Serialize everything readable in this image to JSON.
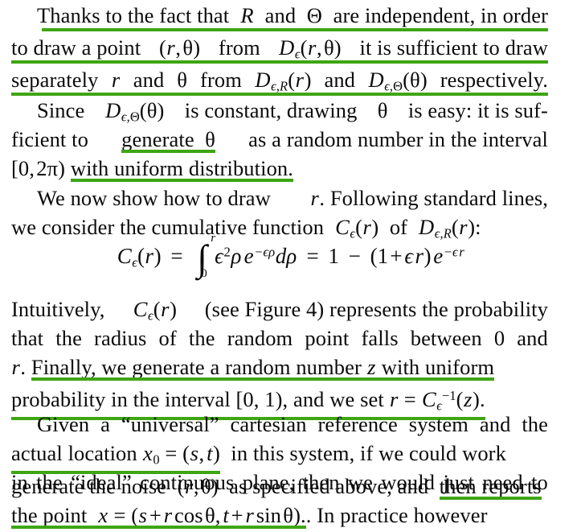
{
  "document": {
    "type": "scanned-paper-excerpt",
    "background_color": "#ffffff",
    "text_color": "#0b0b0b",
    "highlight_color": "#3ea513",
    "highlight_style": "green-underline"
  },
  "paragraphs": [
    {
      "id": "p1",
      "lines": [
        "Thanks to the fact that R and Θ are independent, in order",
        "to draw a point (r, θ) from Dε(r, θ) it is sufficient to draw",
        "separately r and θ from Dε,R(r) and Dε,Θ(θ) respectively."
      ],
      "underlined": "all-three-lines-full-width"
    },
    {
      "id": "p2",
      "lines": [
        "Since Dε,Θ(θ) is constant, drawing θ is easy: it is suf-",
        "ficient to generate θ as a random number in the interval",
        "[0, 2π) with uniform distribution."
      ],
      "underlined": [
        "generate θ",
        "with uniform distribution."
      ]
    },
    {
      "id": "p3",
      "lines": [
        "We now show how to draw r. Following standard lines,",
        "we consider the cumulative function Cε(r) of Dε,R(r):"
      ],
      "underlined": []
    },
    {
      "id": "p4",
      "lines": [
        "Intuitively, Cε(r) (see Figure 4) represents the probability",
        "that the radius of the random point falls between 0 and",
        "r. Finally, we generate a random number z with uniform",
        "probability in the interval [0, 1), and we set r = Cε⁻¹(z)."
      ],
      "underlined": [
        "Finally, we generate a random number z with uniform",
        "probability in the interval [0, 1), and we set r = Cε⁻¹(z)."
      ]
    },
    {
      "id": "p5",
      "lines": [
        "Given a “universal” cartesian reference system and the",
        "actual location x0 = (s, t) in this system, if we could work",
        "in the “ideal” continuous plane, then we would just need to",
        "generate the noise (r, θ) as specified above, and then reports",
        "the point x = (s + r cos θ, t + r sin θ). In practice however"
      ],
      "underlined": [
        "actual location x0 = (s, t)",
        "then reports",
        "the point x = (s + r cos θ, t + r sin θ)."
      ]
    }
  ],
  "equation": {
    "id": "eq1",
    "latex": "C_\\epsilon(r) = \\int_0^r \\epsilon^2 \\rho e^{-\\epsilon\\rho} d\\rho = 1 - (1+\\epsilon r) e^{-\\epsilon r}",
    "plain": "Cε(r) = ∫₀ʳ ε²ρe⁻ᵉᵖdρ = 1 − (1 + εr)e⁻ᵉʳ",
    "integral_lower": "0",
    "integral_upper": "r"
  },
  "text": {
    "p1l1_a": "Thanks to the fact that",
    "p1l1_R": "R",
    "p1l1_b": "and",
    "p1l1_Theta": "Θ",
    "p1l1_c": "are independent, in order",
    "p1l2_a": "to draw a point",
    "p1l2_b": "it is sufficient to draw",
    "p1l3_a": "separately",
    "p1l3_r": "r",
    "p1l3_and1": "and",
    "p1l3_th": "θ",
    "p1l3_from": "from",
    "p1l3_and2": "and",
    "p1l3_end": "respectively.",
    "p2l1_a": "Since",
    "p2l1_b": "is constant, drawing",
    "p2l1_th": "θ",
    "p2l1_c": "is easy: it is suf-",
    "p2l2_a": "ficient to",
    "p2l2_gen": "generate",
    "p2l2_th": "θ",
    "p2l2_b": "as a random number in the interval",
    "p2l3_int": "[0, 2π)",
    "p2l3_b": "with uniform distribution.",
    "p3l1_a": "We now show how to draw",
    "p3l1_r": "r",
    "p3l1_b": ". Following standard lines,",
    "p3l2_a": "we consider the cumulative function",
    "p3l2_b": "of",
    "p3l2_colon": ":",
    "p4l1_a": "Intuitively,",
    "p4l1_b": "(see Figure 4) represents the probability",
    "p4l2": "that the radius of the random point falls between 0 and",
    "p4l3_r": "r",
    "p4l3_a": ". Finally, we generate a random number",
    "p4l3_z": "z",
    "p4l3_b": "with uniform",
    "p4l4_a": "probability in the interval [0, 1), and we set",
    "p4l4_r": "r",
    "p4l4_eq": "=",
    "p4l4_end": ".",
    "p5l1": "Given a “universal” cartesian reference system and the",
    "p5l2_a": "actual location",
    "p5l2_b": "in this system, if we could work",
    "p5l3": "in the “ideal” continuous plane, then we would just need to",
    "p5l4_a": "generate the noise",
    "p5l4_b": "as specified above, and",
    "p5l4_hl": "then reports",
    "p5l5_a": "the point",
    "p5l5_b": ". In practice however",
    "num_1": "1",
    "minus": "−",
    "plus": "+",
    "equals": "=",
    "paren_open": "(",
    "paren_close": ")",
    "eps": "ϵ",
    "rho": "ρ",
    "theta": "θ",
    "pi": "π"
  }
}
